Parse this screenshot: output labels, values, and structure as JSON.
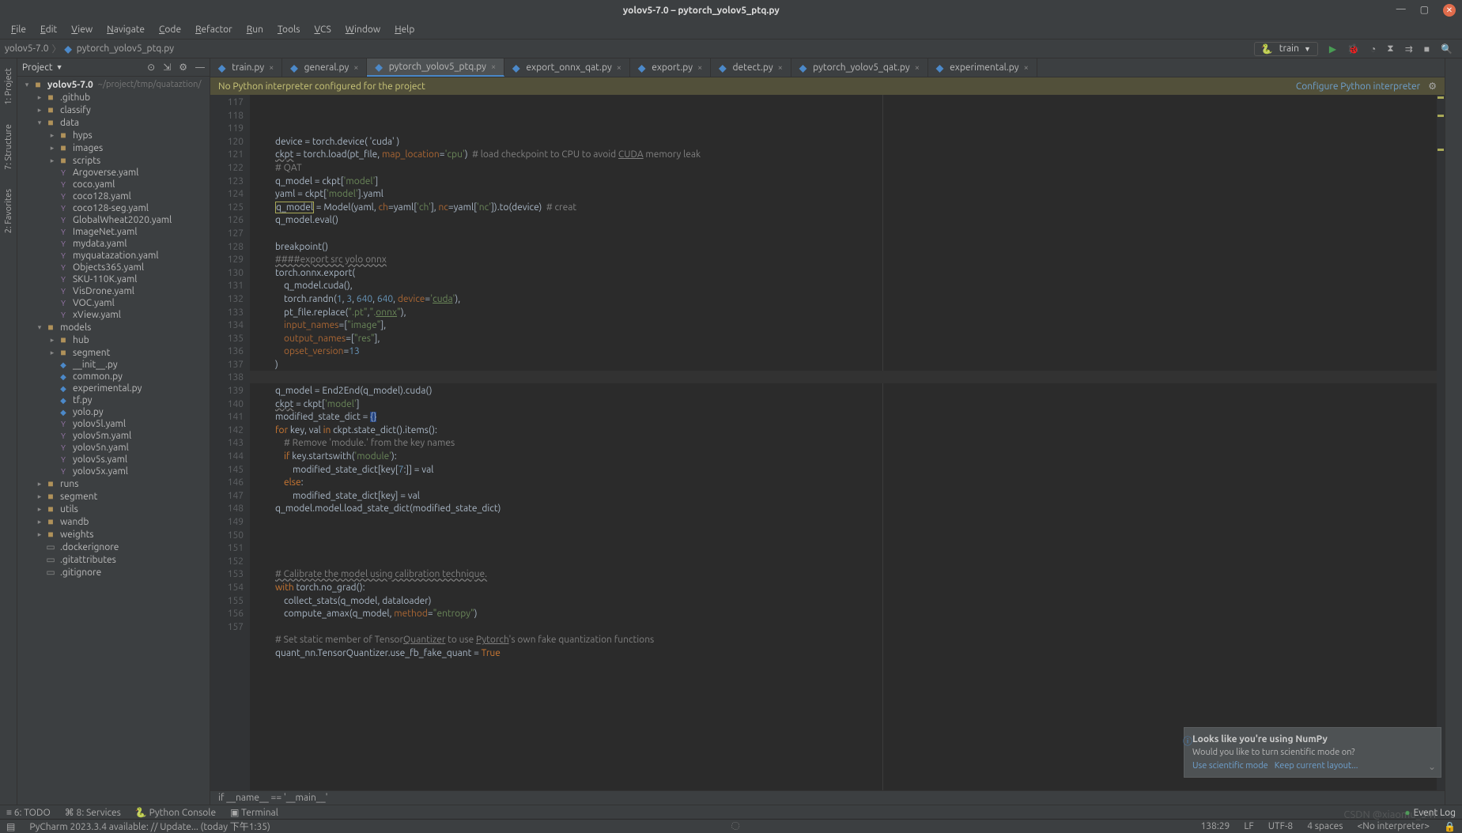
{
  "window": {
    "title": "yolov5-7.0 – pytorch_yolov5_ptq.py"
  },
  "menu": [
    "File",
    "Edit",
    "View",
    "Navigate",
    "Code",
    "Refactor",
    "Run",
    "Tools",
    "VCS",
    "Window",
    "Help"
  ],
  "breadcrumb": {
    "project": "yolov5-7.0",
    "file": "pytorch_yolov5_ptq.py"
  },
  "toolbar": {
    "run_config": "train"
  },
  "left_tabs": [
    "1: Project",
    "7: Structure",
    "2: Favorites"
  ],
  "project_panel": {
    "title": "Project",
    "root": {
      "name": "yolov5-7.0",
      "path": "~/project/tmp/quataztion/"
    },
    "tree": [
      {
        "d": 1,
        "t": "dir",
        "n": ".github",
        "arrow": "▸"
      },
      {
        "d": 1,
        "t": "dir",
        "n": "classify",
        "arrow": "▸"
      },
      {
        "d": 1,
        "t": "dir",
        "n": "data",
        "arrow": "▾"
      },
      {
        "d": 2,
        "t": "dir",
        "n": "hyps",
        "arrow": "▸"
      },
      {
        "d": 2,
        "t": "dir",
        "n": "images",
        "arrow": "▸"
      },
      {
        "d": 2,
        "t": "dir",
        "n": "scripts",
        "arrow": "▸"
      },
      {
        "d": 2,
        "t": "yaml",
        "n": "Argoverse.yaml"
      },
      {
        "d": 2,
        "t": "yaml",
        "n": "coco.yaml"
      },
      {
        "d": 2,
        "t": "yaml",
        "n": "coco128.yaml"
      },
      {
        "d": 2,
        "t": "yaml",
        "n": "coco128-seg.yaml"
      },
      {
        "d": 2,
        "t": "yaml",
        "n": "GlobalWheat2020.yaml"
      },
      {
        "d": 2,
        "t": "yaml",
        "n": "ImageNet.yaml"
      },
      {
        "d": 2,
        "t": "yaml",
        "n": "mydata.yaml"
      },
      {
        "d": 2,
        "t": "yaml",
        "n": "myquatazation.yaml"
      },
      {
        "d": 2,
        "t": "yaml",
        "n": "Objects365.yaml"
      },
      {
        "d": 2,
        "t": "yaml",
        "n": "SKU-110K.yaml"
      },
      {
        "d": 2,
        "t": "yaml",
        "n": "VisDrone.yaml"
      },
      {
        "d": 2,
        "t": "yaml",
        "n": "VOC.yaml"
      },
      {
        "d": 2,
        "t": "yaml",
        "n": "xView.yaml"
      },
      {
        "d": 1,
        "t": "dir",
        "n": "models",
        "arrow": "▾"
      },
      {
        "d": 2,
        "t": "dir",
        "n": "hub",
        "arrow": "▸"
      },
      {
        "d": 2,
        "t": "dir",
        "n": "segment",
        "arrow": "▸"
      },
      {
        "d": 2,
        "t": "py",
        "n": "__init__.py"
      },
      {
        "d": 2,
        "t": "py",
        "n": "common.py"
      },
      {
        "d": 2,
        "t": "py",
        "n": "experimental.py"
      },
      {
        "d": 2,
        "t": "py",
        "n": "tf.py"
      },
      {
        "d": 2,
        "t": "py",
        "n": "yolo.py"
      },
      {
        "d": 2,
        "t": "yaml",
        "n": "yolov5l.yaml"
      },
      {
        "d": 2,
        "t": "yaml",
        "n": "yolov5m.yaml"
      },
      {
        "d": 2,
        "t": "yaml",
        "n": "yolov5n.yaml"
      },
      {
        "d": 2,
        "t": "yaml",
        "n": "yolov5s.yaml"
      },
      {
        "d": 2,
        "t": "yaml",
        "n": "yolov5x.yaml"
      },
      {
        "d": 1,
        "t": "dir",
        "n": "runs",
        "arrow": "▸"
      },
      {
        "d": 1,
        "t": "dir",
        "n": "segment",
        "arrow": "▸"
      },
      {
        "d": 1,
        "t": "dir",
        "n": "utils",
        "arrow": "▸"
      },
      {
        "d": 1,
        "t": "dir",
        "n": "wandb",
        "arrow": "▸"
      },
      {
        "d": 1,
        "t": "dir",
        "n": "weights",
        "arrow": "▸"
      },
      {
        "d": 1,
        "t": "file",
        "n": ".dockerignore"
      },
      {
        "d": 1,
        "t": "file",
        "n": ".gitattributes"
      },
      {
        "d": 1,
        "t": "file",
        "n": ".gitignore"
      }
    ]
  },
  "tabs": [
    {
      "label": "train.py"
    },
    {
      "label": "general.py"
    },
    {
      "label": "pytorch_yolov5_ptq.py",
      "active": true
    },
    {
      "label": "export_onnx_qat.py"
    },
    {
      "label": "export.py"
    },
    {
      "label": "detect.py"
    },
    {
      "label": "pytorch_yolov5_qat.py"
    },
    {
      "label": "experimental.py"
    }
  ],
  "banner": {
    "msg": "No Python interpreter configured for the project",
    "link": "Configure Python interpreter"
  },
  "code": {
    "first_line": 117,
    "caret_line": 138,
    "lines": [
      "        device = torch.device( 'cuda' )",
      "        <span class='uline'>ckpt</span> = torch.load(pt_file, <span class='param'>map_location</span>=<span class='str'>'cpu'</span>)  <span class='cmt'># load checkpoint to CPU to avoid <u>CUDA</u> memory leak</span>",
      "        <span class='cmt'># QAT</span>",
      "        q_model = ckpt[<span class='str'>'model'</span>]",
      "        yaml = ckpt[<span class='str'>'model'</span>].yaml",
      "        <span class='boxwarn'>q_model</span> = Model(yaml, <span class='param'>ch</span>=yaml[<span class='str'>'ch'</span>], <span class='param'>nc</span>=yaml[<span class='str'>'nc'</span>]).to(device)  <span class='cmt'># creat</span>",
      "        q_model.eval()",
      "",
      "        breakpoint()",
      "        <span class='cmt uline'>####export src yolo onnx</span>",
      "        torch.onnx.export(",
      "            q_model.cuda(),",
      "            torch.randn(<span class='num'>1</span>, <span class='num'>3</span>, <span class='num'>640</span>, <span class='num'>640</span>, <span class='param'>device</span>=<span class='str'>'<u>cuda</u>'</span>),",
      "            pt_file.replace(<span class='str'>\".pt\"</span>,<span class='str'>\".<u>onnx</u>\"</span>),",
      "            <span class='param'>input_names</span>=[<span class='str'>\"image\"</span>],",
      "            <span class='param'>output_names</span>=[<span class='str'>\"res\"</span>],",
      "            <span class='param'>opset_version</span>=<span class='num'>13</span>",
      "        )",
      "",
      "        q_model = End2End(q_model).cuda()",
      "        <span class='uline'>ckpt</span> = ckpt[<span class='str'>'model'</span>]",
      "        modified_state_dict = <span class='sel'>{}</span>",
      "        <span class='kw'>for</span> key, val <span class='kw'>in</span> ckpt.state_dict().items():",
      "            <span class='cmt'># Remove 'module.' from the key names</span>",
      "            <span class='kw'>if</span> key.startswith(<span class='str'>'module'</span>):",
      "                modified_state_dict[key[<span class='num'>7</span>:]] = val",
      "            <span class='kw'>else</span>:",
      "                modified_state_dict[key] = val",
      "        q_model.model.load_state_dict(modified_state_dict)",
      "",
      "",
      "",
      "",
      "        <span class='cmt uline'># Calibrate the model using calibration technique.</span>",
      "        <span class='kw'>with</span> torch.no_grad():",
      "            collect_stats(q_model, dataloader)",
      "            compute_amax(q_model, <span class='param'>method</span>=<span class='str'>\"entropy\"</span>)",
      "",
      "        <span class='cmt'># Set static member of Tensor<u>Quantizer</u> to use <u>Pytorch</u>'s own fake quantization functions</span>",
      "        quant_nn.TensorQuantizer.use_fb_fake_quant = <span class='kw'>True</span>",
      ""
    ]
  },
  "code_footer": "if __name__ == '__main__'",
  "notification": {
    "title": "Looks like you're using NumPy",
    "body": "Would you like to turn scientific mode on?",
    "links": [
      "Use scientific mode",
      "Keep current layout..."
    ]
  },
  "bottom_tools": [
    "≡ 6: TODO",
    "⌘ 8: Services",
    "🐍 Python Console",
    "▣ Terminal"
  ],
  "event_log": "Event Log",
  "status": {
    "update": "PyCharm 2023.3.4 available: // Update... (today 下午1:35)",
    "pos": "138:29",
    "sep": "LF",
    "enc": "UTF-8",
    "indent": "4 spaces",
    "interp": "<No interpreter>",
    "watermark": "CSDN @xiaomu_347"
  }
}
